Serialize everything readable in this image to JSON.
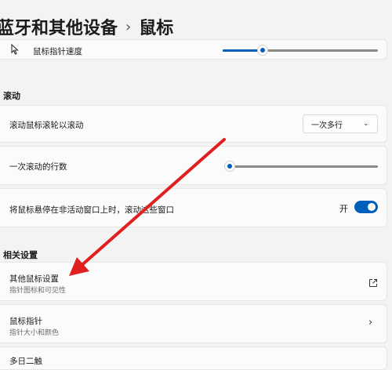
{
  "breadcrumb": {
    "parent": "蓝牙和其他设备",
    "chevron": "›",
    "current": "鼠标"
  },
  "pointer_speed": {
    "label": "鼠标指针速度",
    "value_fraction": 0.26
  },
  "scroll_section": {
    "title": "滚动",
    "wheel_mode": {
      "label": "滚动鼠标滚轮以滚动",
      "selected": "一次多行",
      "chevron": "⌄"
    },
    "lines": {
      "label": "一次滚动的行数",
      "value_fraction": 0.02
    },
    "inactive_scroll": {
      "label": "将鼠标悬停在非活动窗口上时，滚动这些窗口",
      "state": "开",
      "on": true
    }
  },
  "related_section": {
    "title": "相关设置",
    "items": [
      {
        "title": "其他鼠标设置",
        "subtitle": "指针图标和可见性"
      },
      {
        "title": "鼠标指针",
        "subtitle": "指针大小和颜色",
        "chevron": "›"
      },
      {
        "title": "多日二触"
      }
    ]
  },
  "annotation": {
    "arrow_color": "#e02020"
  }
}
